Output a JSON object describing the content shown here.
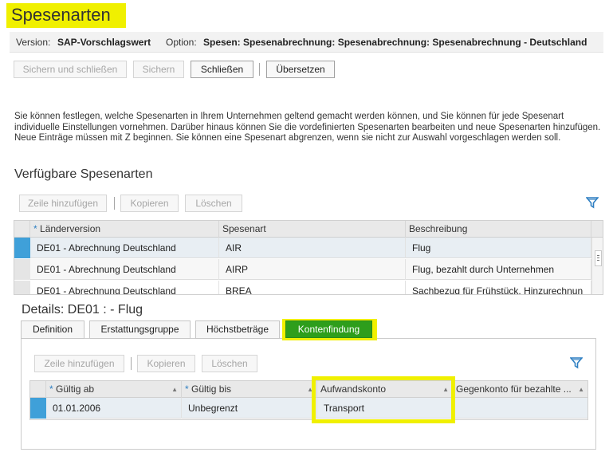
{
  "page": {
    "title": "Spesenarten"
  },
  "info": {
    "version_label": "Version:",
    "version_value": "SAP-Vorschlagswert",
    "option_label": "Option:",
    "option_value": "Spesen: Spesenabrechnung: Spesenabrechnung: Spesenabrechnung - Deutschland"
  },
  "toolbar": {
    "save_close": "Sichern und schließen",
    "save": "Sichern",
    "close": "Schließen",
    "translate": "Übersetzen"
  },
  "description": "Sie können festlegen, welche Spesenarten in Ihrem Unternehmen geltend gemacht werden können, und Sie können für jede Spesenart individuelle Einstellungen vornehmen. Darüber hinaus können Sie die vordefinierten Spesenarten bearbeiten und neue Spesenarten hinzufügen. Neue Einträge müssen mit Z beginnen. Sie können eine Spesenart abgrenzen, wenn sie nicht zur Auswahl vorgeschlagen werden soll.",
  "available": {
    "title": "Verfügbare Spesenarten",
    "add_row": "Zeile hinzufügen",
    "copy": "Kopieren",
    "delete": "Löschen",
    "columns": [
      "Länderversion",
      "Spesenart",
      "Beschreibung"
    ],
    "rows": [
      [
        "DE01 - Abrechnung Deutschland",
        "AIR",
        "Flug"
      ],
      [
        "DE01 - Abrechnung Deutschland",
        "AIRP",
        "Flug, bezahlt durch Unternehmen"
      ],
      [
        "DE01 - Abrechnung Deutschland",
        "BREA",
        "Sachbezug für Frühstück, Hinzurechnun"
      ]
    ]
  },
  "details": {
    "title": "Details: DE01 : - Flug",
    "tabs": [
      "Definition",
      "Erstattungsgruppe",
      "Höchstbeträge",
      "Kontenfindung"
    ],
    "add_row": "Zeile hinzufügen",
    "copy": "Kopieren",
    "delete": "Löschen",
    "columns": [
      "Gültig ab",
      "Gültig bis",
      "Aufwandskonto",
      "Gegenkonto für bezahlte ..."
    ],
    "rows": [
      [
        "01.01.2006",
        "Unbegrenzt",
        "Transport",
        ""
      ]
    ]
  },
  "icons": {
    "filter": "filter-icon",
    "sort": "sort-icon",
    "scroll": "scroll-handle-icon"
  },
  "colors": {
    "highlight": "#f0f000",
    "active_tab": "#2e9e1c",
    "row_selected": "#3fa0d9",
    "link_blue": "#2e7fc2"
  }
}
